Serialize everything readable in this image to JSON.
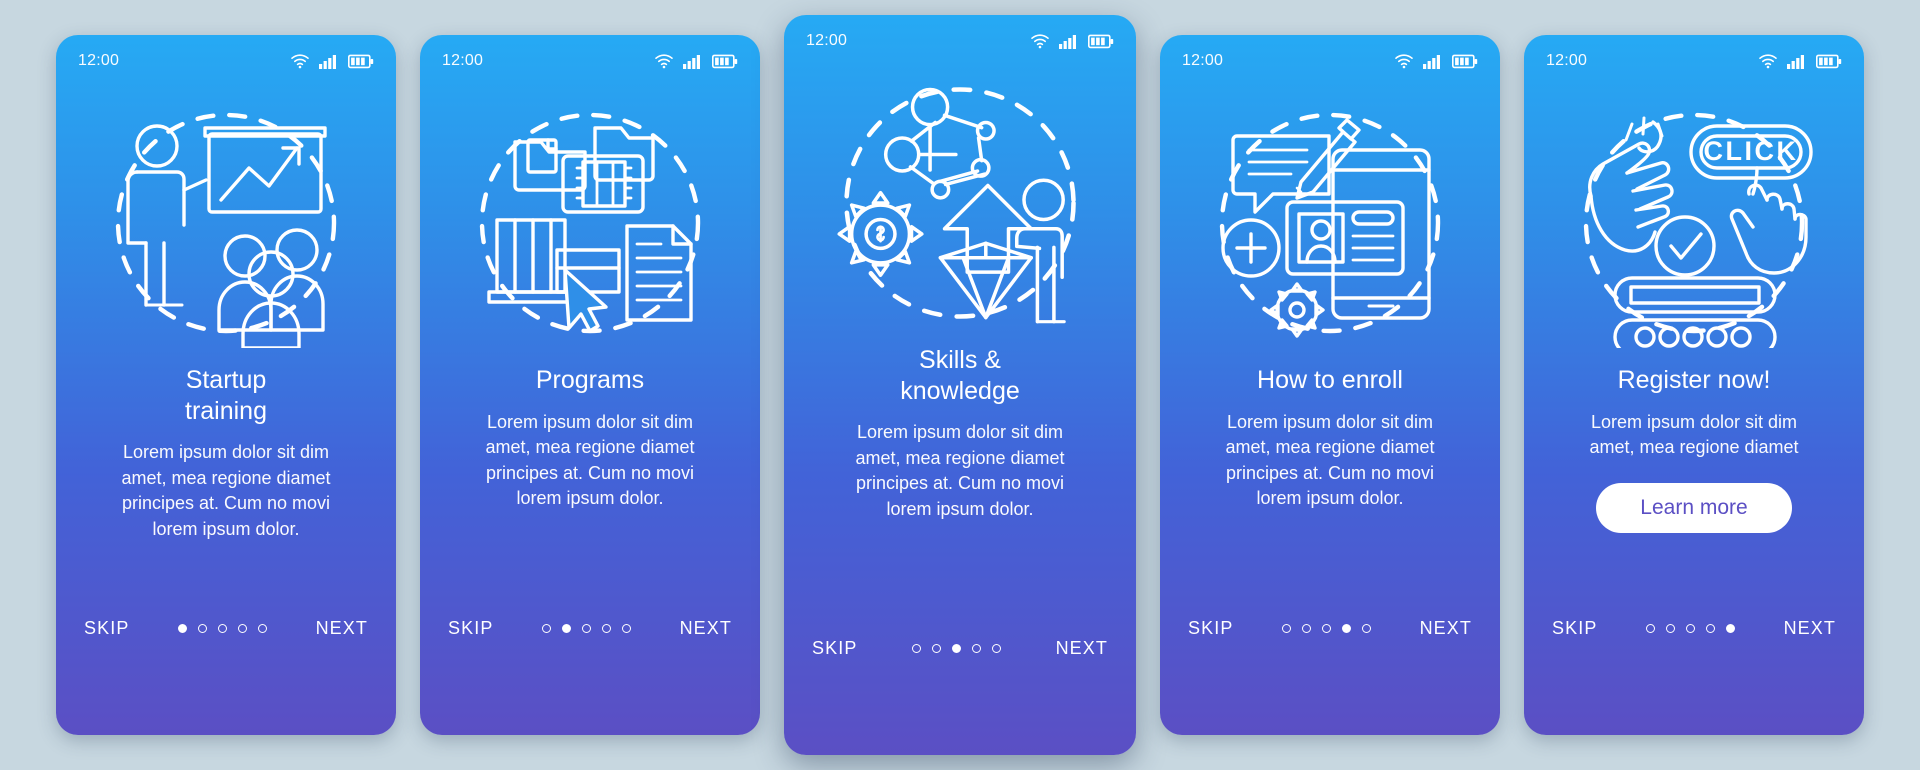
{
  "background_color": "#c7d7e0",
  "common": {
    "status_time": "12:00",
    "wifi_icon": "wifi-icon",
    "signal_icon": "signal-bars-icon",
    "battery_icon": "battery-icon",
    "skip_label": "SKIP",
    "next_label": "NEXT",
    "total_steps": 5
  },
  "gradient": {
    "top": "#26aaf4",
    "bottom": "#5b4fc4"
  },
  "screens": [
    {
      "id": "startup-training",
      "title": "Startup\ntraining",
      "body": "Lorem ipsum dolor sit dim\namet, mea regione diamet\nprincipes at. Cum no movi\nlorem ipsum dolor.",
      "active_dot": 1,
      "illustration": "presentation-training-illustration",
      "featured": false,
      "cta": null
    },
    {
      "id": "programs",
      "title": "Programs",
      "body": "Lorem ipsum dolor sit dim\namet, mea regione diamet\nprincipes at. Cum no movi\nlorem ipsum dolor.",
      "active_dot": 2,
      "illustration": "media-library-illustration",
      "featured": false,
      "cta": null
    },
    {
      "id": "skills-knowledge",
      "title": "Skills &\nknowledge",
      "body": "Lorem ipsum dolor sit dim\namet, mea regione diamet\nprincipes at. Cum no movi\nlorem ipsum dolor.",
      "active_dot": 3,
      "illustration": "skills-growth-illustration",
      "featured": true,
      "cta": null
    },
    {
      "id": "how-to-enroll",
      "title": "How to enroll",
      "body": "Lorem ipsum dolor sit dim\namet, mea regione diamet\nprincipes at. Cum no movi\nlorem ipsum dolor.",
      "active_dot": 4,
      "illustration": "enrollment-form-illustration",
      "featured": false,
      "cta": null
    },
    {
      "id": "register-now",
      "title": "Register now!",
      "body": "Lorem ipsum dolor sit dim\namet, mea regione diamet",
      "active_dot": 5,
      "illustration": "click-register-illustration",
      "featured": false,
      "cta": "Learn more",
      "illustration_text": "CLICK"
    }
  ]
}
